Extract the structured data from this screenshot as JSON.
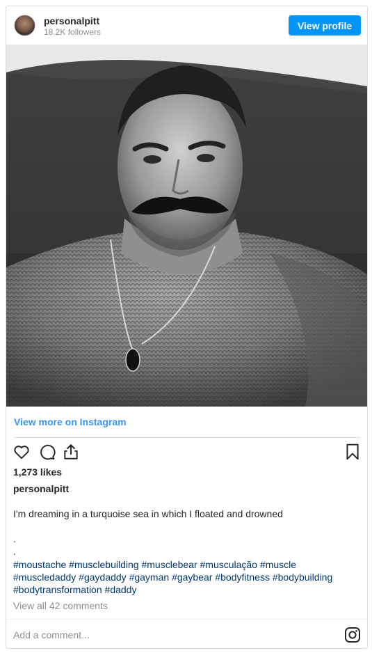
{
  "header": {
    "username": "personalpitt",
    "followers": "18.2K followers",
    "view_profile_label": "View profile"
  },
  "post": {
    "image_alt": "Black and white selfie of a man with a moustache lying on a couch",
    "view_more_label": "View more on Instagram",
    "likes": "1,273 likes",
    "caption_user": "personalpitt",
    "caption_text": "I'm dreaming in a turquoise sea in which I floated and drowned",
    "dots": [
      ".",
      "."
    ],
    "hashtags": [
      "#moustache",
      "#musclebuilding",
      "#musclebear",
      "#musculação",
      "#muscle",
      "#muscledaddy",
      "#gaydaddy",
      "#gayman",
      "#gaybear",
      "#bodyfitness",
      "#bodybuilding",
      "#bodytransformation",
      "#daddy"
    ],
    "view_comments_label": "View all 42 comments"
  },
  "actions": {
    "icons": [
      "heart-icon",
      "comment-icon",
      "share-icon",
      "bookmark-icon"
    ]
  },
  "comment": {
    "placeholder": "Add a comment..."
  },
  "colors": {
    "accent": "#0095f6",
    "link": "#3897f0",
    "hashtag": "#00376b",
    "muted": "#8e8e8e",
    "border": "#dbdbdb"
  }
}
